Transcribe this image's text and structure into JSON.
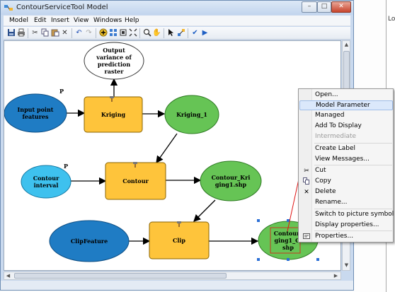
{
  "background_window": {
    "partial_text": "Lo"
  },
  "window": {
    "title": "ContourServiceTool Model",
    "buttons": {
      "minimize": "–",
      "maximize": "□",
      "close": "✕"
    }
  },
  "menubar": {
    "items": [
      "Model",
      "Edit",
      "Insert",
      "View",
      "Windows",
      "Help"
    ]
  },
  "toolbar": {
    "icons": [
      "save-icon",
      "print-icon",
      "cut-icon",
      "copy-icon",
      "paste-icon",
      "delete-icon",
      "undo-icon",
      "redo-icon",
      "add-data-icon",
      "auto-layout-icon",
      "full-extent-icon",
      "zoom-icon",
      "zoom-in-fixed-icon",
      "pan-icon",
      "select-icon",
      "connect-icon",
      "validate-icon",
      "run-icon"
    ]
  },
  "model": {
    "nodes": {
      "input_point": "Input point\nfeatures",
      "kriging": "Kriging",
      "kriging_out": "Kriging_1",
      "variance": "Output\nvariance of\nprediction\nraster",
      "contour_interval": "Contour\ninterval",
      "contour": "Contour",
      "contour_out": "Contour_Kri\nging1.shp",
      "clip_feature": "ClipFeature",
      "clip": "Clip",
      "clip_out": "Contour_\nging1_Cl\nshp"
    },
    "parameter_markers": [
      "P",
      "P"
    ]
  },
  "context_menu": {
    "items": [
      {
        "label": "Open...",
        "icon": "",
        "state": "normal"
      },
      {
        "label": "Model Parameter",
        "icon": "",
        "state": "highlighted"
      },
      {
        "label": "Managed",
        "icon": "",
        "state": "normal"
      },
      {
        "label": "Add To Display",
        "icon": "",
        "state": "normal"
      },
      {
        "label": "Intermediate",
        "icon": "",
        "state": "disabled"
      },
      {
        "label": "Create Label",
        "icon": "",
        "state": "normal"
      },
      {
        "label": "View Messages...",
        "icon": "",
        "state": "normal"
      },
      {
        "label": "Cut",
        "icon": "cut-icon",
        "state": "normal"
      },
      {
        "label": "Copy",
        "icon": "copy-icon",
        "state": "normal"
      },
      {
        "label": "Delete",
        "icon": "delete-icon",
        "state": "normal"
      },
      {
        "label": "Rename...",
        "icon": "",
        "state": "normal"
      },
      {
        "label": "Switch to picture symbol",
        "icon": "",
        "state": "normal"
      },
      {
        "label": "Display properties...",
        "icon": "",
        "state": "normal"
      },
      {
        "label": "Properties...",
        "icon": "properties-icon",
        "state": "normal"
      }
    ]
  },
  "colors": {
    "input_data": "#1f7cc4",
    "input_value": "#3ec1ee",
    "tool": "#fec43b",
    "derived_data": "#66c455",
    "annotation_arrow": "#e01515",
    "menu_highlight": "#dbe8fb"
  }
}
